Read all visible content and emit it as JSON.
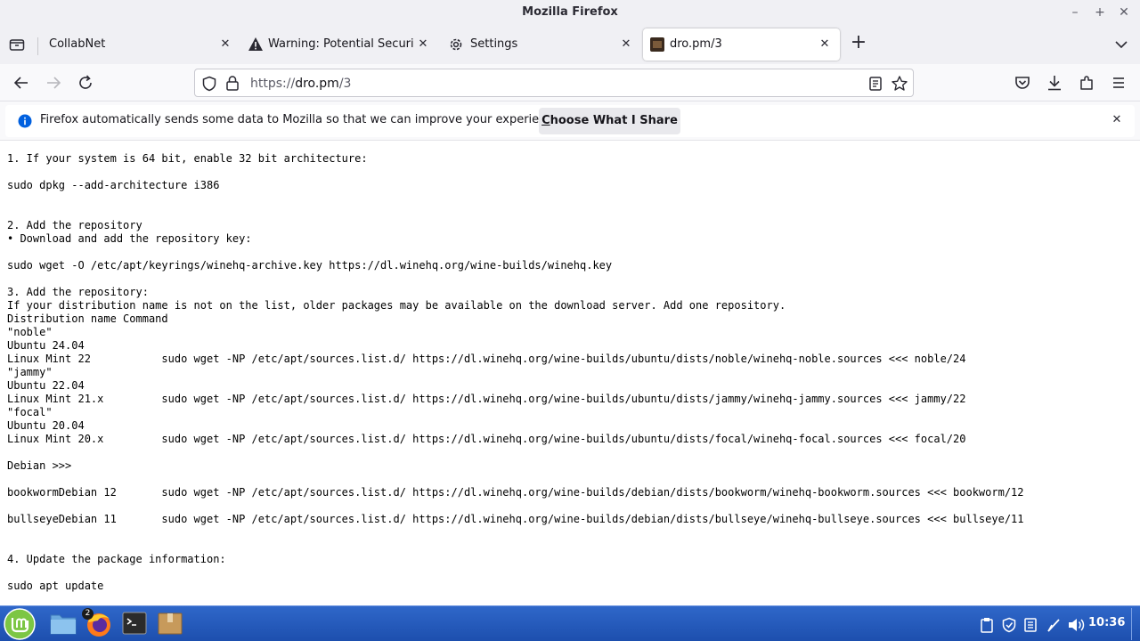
{
  "window": {
    "title": "Mozilla Firefox",
    "minimize_icon": "minimize-icon",
    "maximize_icon": "maximize-icon",
    "close_icon": "close-icon"
  },
  "tabs": [
    {
      "label": "CollabNet",
      "icon": "none",
      "active": false
    },
    {
      "label": "Warning: Potential Security Risk Ahead",
      "icon": "warning-icon",
      "active": false
    },
    {
      "label": "Settings",
      "icon": "gear-icon",
      "active": false
    },
    {
      "label": "dro.pm/3",
      "icon": "site-favicon",
      "active": true
    }
  ],
  "new_tab_label": "+",
  "navbar": {
    "url_scheme": "https://",
    "url_host": "dro.pm",
    "url_path": "/3"
  },
  "notification": {
    "message": "Firefox automatically sends some data to Mozilla so that we can improve your experience.",
    "button_underlined": "C",
    "button_rest": "hoose What I Share"
  },
  "content_lines": [
    "1. If your system is 64 bit, enable 32 bit architecture:",
    "",
    "sudo dpkg --add-architecture i386",
    "",
    "",
    "2. Add the repository",
    "• Download and add the repository key:",
    "",
    "sudo wget -O /etc/apt/keyrings/winehq-archive.key https://dl.winehq.org/wine-builds/winehq.key",
    "",
    "3. Add the repository:",
    "If your distribution name is not on the list, older packages may be available on the download server. Add one repository.",
    "Distribution name Command",
    "\"noble\"",
    "Ubuntu 24.04",
    "Linux Mint 22           sudo wget -NP /etc/apt/sources.list.d/ https://dl.winehq.org/wine-builds/ubuntu/dists/noble/winehq-noble.sources <<< noble/24",
    "\"jammy\"",
    "Ubuntu 22.04",
    "Linux Mint 21.x         sudo wget -NP /etc/apt/sources.list.d/ https://dl.winehq.org/wine-builds/ubuntu/dists/jammy/winehq-jammy.sources <<< jammy/22",
    "\"focal\"",
    "Ubuntu 20.04",
    "Linux Mint 20.x         sudo wget -NP /etc/apt/sources.list.d/ https://dl.winehq.org/wine-builds/ubuntu/dists/focal/winehq-focal.sources <<< focal/20",
    "",
    "Debian >>>",
    "",
    "bookwormDebian 12       sudo wget -NP /etc/apt/sources.list.d/ https://dl.winehq.org/wine-builds/debian/dists/bookworm/winehq-bookworm.sources <<< bookworm/12",
    "",
    "bullseyeDebian 11       sudo wget -NP /etc/apt/sources.list.d/ https://dl.winehq.org/wine-builds/debian/dists/bullseye/winehq-bullseye.sources <<< bullseye/11",
    "",
    "",
    "4. Update the package information:",
    "",
    "sudo apt update"
  ],
  "taskbar": {
    "firefox_badge": "2",
    "clock": "10:36"
  },
  "colors": {
    "taskbar": "#2a5fc0",
    "accent_blue": "#0060df",
    "mint_green": "#7cc644"
  }
}
